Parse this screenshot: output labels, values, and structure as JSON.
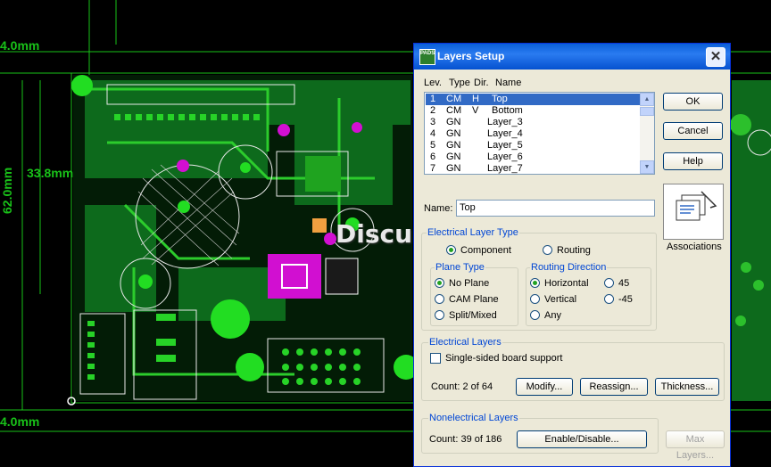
{
  "background": {
    "dimensions": [
      "4.0mm",
      "33.8mm",
      "62.0mm",
      "4.0mm"
    ],
    "watermark": "Discuz!"
  },
  "dialog": {
    "icon_text": "PADS",
    "title": "Layers Setup",
    "close_glyph": "✕",
    "list_header": {
      "lev": "Lev.",
      "type": "Type",
      "dir": "Dir.",
      "name": "Name"
    },
    "layers": [
      {
        "lev": "1",
        "type": "CM",
        "dir": "H",
        "name": "Top"
      },
      {
        "lev": "2",
        "type": "CM",
        "dir": "V",
        "name": "Bottom"
      },
      {
        "lev": "3",
        "type": "GN",
        "dir": "",
        "name": "Layer_3"
      },
      {
        "lev": "4",
        "type": "GN",
        "dir": "",
        "name": "Layer_4"
      },
      {
        "lev": "5",
        "type": "GN",
        "dir": "",
        "name": "Layer_5"
      },
      {
        "lev": "6",
        "type": "GN",
        "dir": "",
        "name": "Layer_6"
      },
      {
        "lev": "7",
        "type": "GN",
        "dir": "",
        "name": "Layer_7"
      }
    ],
    "buttons": {
      "ok": "OK",
      "cancel": "Cancel",
      "help": "Help"
    },
    "name_label": "Name:",
    "name_value": "Top",
    "associations_label": "Associations",
    "electrical_layer_type": {
      "title": "Electrical  Layer Type",
      "component": "Component",
      "routing": "Routing"
    },
    "plane_type": {
      "title": "Plane Type",
      "no_plane": "No Plane",
      "cam_plane": "CAM Plane",
      "split_mixed": "Split/Mixed"
    },
    "routing_direction": {
      "title": "Routing Direction",
      "horizontal": "Horizontal",
      "vertical": "Vertical",
      "any": "Any",
      "d45": "45",
      "dm45": "-45"
    },
    "electrical_layers": {
      "title": "Electrical Layers",
      "single_sided": "Single-sided board support",
      "count": "Count:  2 of 64",
      "modify": "Modify...",
      "reassign": "Reassign...",
      "thickness": "Thickness..."
    },
    "nonelectrical_layers": {
      "title": "Nonelectrical Layers",
      "count": "Count: 39 of 186",
      "enable_disable": "Enable/Disable...",
      "max_layers": "Max Layers..."
    }
  }
}
